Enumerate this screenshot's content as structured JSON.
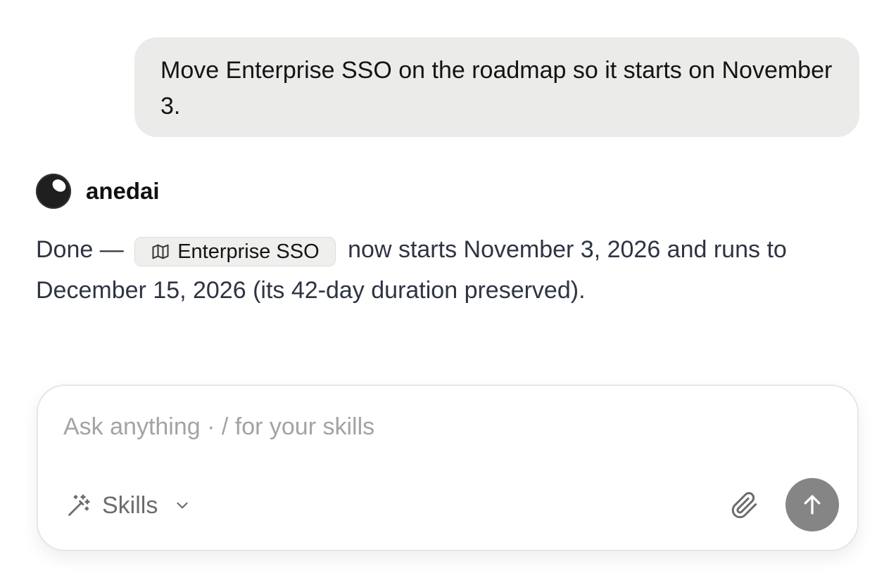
{
  "user_message": {
    "text": "Move Enterprise SSO on the roadmap so it starts on November 3."
  },
  "assistant": {
    "name": "anedai",
    "avatar_icon": "dark-orb-icon",
    "reply": {
      "prefix": "Done —",
      "chip": {
        "icon": "map-icon",
        "label": "Enterprise SSO"
      },
      "suffix": "now starts November 3, 2026 and runs to December 15, 2026 (its 42-day duration preserved)."
    }
  },
  "composer": {
    "placeholder": "Ask anything · / for your skills",
    "value": "",
    "skills_label": "Skills",
    "skills_icon": "magic-wand-icon",
    "attach_icon": "paperclip-icon",
    "send_icon": "arrow-up-icon",
    "send_button_color": "#858585"
  },
  "colors": {
    "user_bubble_bg": "#ebebea",
    "reply_text": "#2f3443",
    "placeholder_text": "#a3a3a3"
  }
}
